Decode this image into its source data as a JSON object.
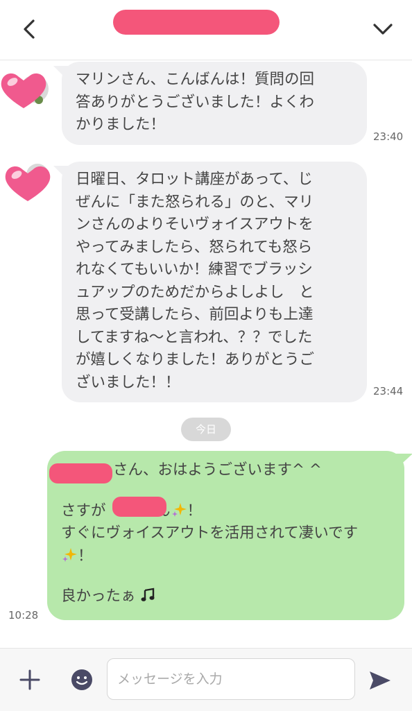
{
  "header": {
    "title": "",
    "back_icon": "chevron-left-icon",
    "menu_icon": "chevron-down-icon"
  },
  "messages": [
    {
      "direction": "in",
      "lines": [
        "マリンさん、こんばんは！質問の回",
        "答ありがとうございました！よくわ",
        "かりました！"
      ],
      "time": "23:40"
    },
    {
      "direction": "in",
      "lines": [
        "日曜日、タロット講座があって、じ",
        "ぜんに「また怒られる」のと、マリ",
        "ンさんのよりそいヴォイスアウトを",
        "やってみましたら、怒られても怒ら",
        "れなくてもいいか！練習でブラッシ",
        "ュアップのためだからよしよし　と",
        "思って受講したら、前回よりも上達",
        "してますね〜と言われ、？？でした",
        "が嬉しくなりました！ありがとうご",
        "ざいました！！"
      ],
      "time": "23:44"
    },
    {
      "direction": "out",
      "line1": "さん、おはようございます^ ^",
      "line2_pre": "さすが",
      "line2_post": "さん",
      "line2_end": "！",
      "line3": "すぐにヴォイスアウトを活用されて凄いです",
      "line4": "！",
      "line5": "良かったぁ",
      "time": "10:28"
    }
  ],
  "date_separator": "今日",
  "composer": {
    "placeholder": "メッセージを入力",
    "value": ""
  },
  "colors": {
    "incoming_bubble": "#f0f0f2",
    "outgoing_bubble": "#b7e8ab",
    "redaction": "#f4567a",
    "heart": "#f05a8e"
  }
}
